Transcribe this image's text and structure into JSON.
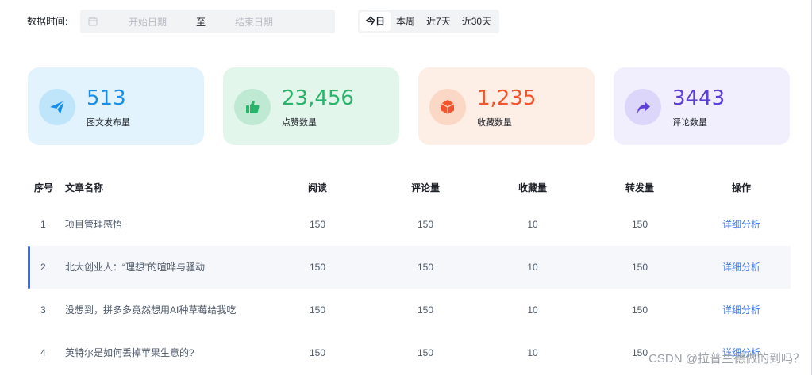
{
  "filter": {
    "label": "数据时间:",
    "start_placeholder": "开始日期",
    "separator": "至",
    "end_placeholder": "结束日期",
    "tabs": [
      {
        "label": "今日",
        "active": true
      },
      {
        "label": "本周",
        "active": false
      },
      {
        "label": "近7天",
        "active": false
      },
      {
        "label": "近30天",
        "active": false
      }
    ]
  },
  "stats": [
    {
      "value": "513",
      "label": "图文发布量",
      "icon": "paper-plane-icon",
      "bg": "#e3f3fd",
      "circle": "#bfe5fb",
      "color": "#1a8fe8"
    },
    {
      "value": "23,456",
      "label": "点赞数量",
      "icon": "thumbs-up-icon",
      "bg": "#e3f6ec",
      "circle": "#bfe9d2",
      "color": "#28b46a"
    },
    {
      "value": "1,235",
      "label": "收藏数量",
      "icon": "box-icon",
      "bg": "#fdeee6",
      "circle": "#fbd7c5",
      "color": "#f2552c"
    },
    {
      "value": "3443",
      "label": "评论数量",
      "icon": "share-arrow-icon",
      "bg": "#f1effd",
      "circle": "#dcd7fa",
      "color": "#5b3fd6"
    }
  ],
  "table": {
    "headers": {
      "index": "序号",
      "title": "文章名称",
      "reads": "阅读",
      "comments": "评论量",
      "favorites": "收藏量",
      "shares": "转发量",
      "actions": "操作"
    },
    "rows": [
      {
        "index": "1",
        "title": "项目管理感悟",
        "reads": "150",
        "comments": "150",
        "favorites": "10",
        "shares": "150",
        "action": "详细分析"
      },
      {
        "index": "2",
        "title": "北大创业人：“理想”的喧哗与骚动",
        "reads": "150",
        "comments": "150",
        "favorites": "10",
        "shares": "150",
        "action": "详细分析"
      },
      {
        "index": "3",
        "title": "没想到，拼多多竟然想用AI种草莓给我吃",
        "reads": "150",
        "comments": "150",
        "favorites": "10",
        "shares": "150",
        "action": "详细分析"
      },
      {
        "index": "4",
        "title": "英特尔是如何丢掉苹果生意的?",
        "reads": "150",
        "comments": "150",
        "favorites": "10",
        "shares": "150",
        "action": "详细分析"
      }
    ]
  },
  "watermark": "CSDN @拉普兰德做的到吗？"
}
